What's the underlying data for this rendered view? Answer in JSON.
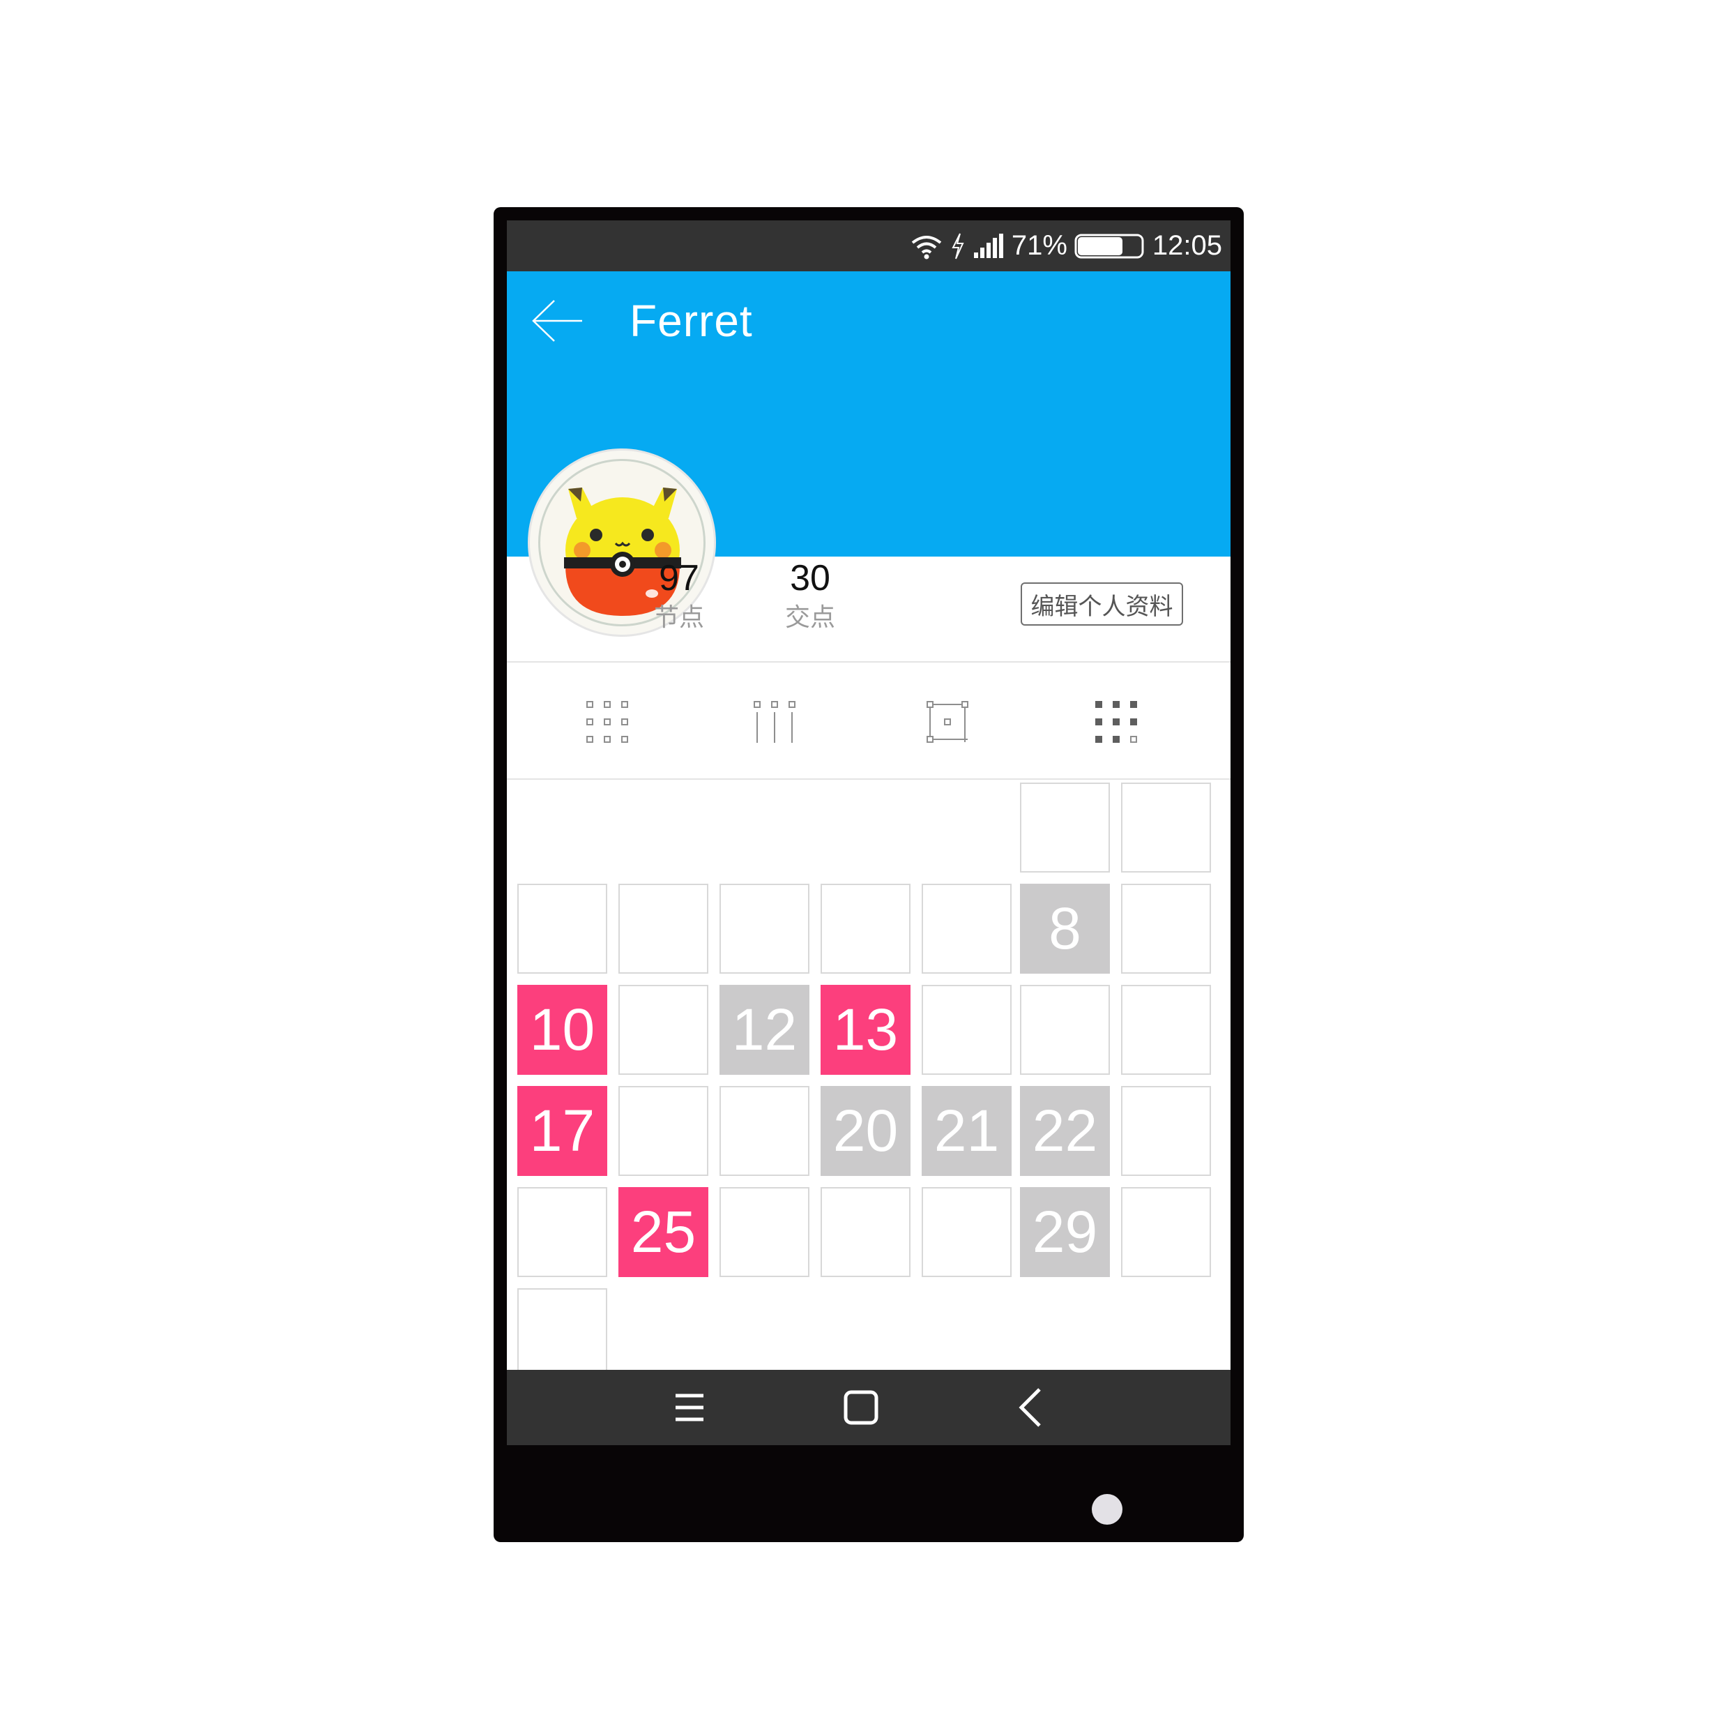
{
  "status": {
    "battery": "71%",
    "time": "12:05",
    "battery_level": 0.71
  },
  "header": {
    "title": "Ferret"
  },
  "profile": {
    "stats": [
      {
        "value": "97",
        "label": "节点"
      },
      {
        "value": "30",
        "label": "交点"
      }
    ],
    "edit_label": "编辑个人资料"
  },
  "view_tabs": [
    "grid-icon",
    "columns-icon",
    "frame-icon",
    "grid-bold-icon"
  ],
  "calendar": {
    "cells": [
      {
        "label": "",
        "style": "empty"
      },
      {
        "label": "",
        "style": "empty"
      },
      {
        "label": "",
        "style": "empty"
      },
      {
        "label": "",
        "style": "empty"
      },
      {
        "label": "",
        "style": "empty"
      },
      {
        "label": "",
        "style": "empty"
      },
      {
        "label": "",
        "style": "empty"
      },
      {
        "label": "8",
        "style": "gray"
      },
      {
        "label": "",
        "style": "empty"
      },
      {
        "label": "10",
        "style": "pink"
      },
      {
        "label": "",
        "style": "empty"
      },
      {
        "label": "12",
        "style": "gray"
      },
      {
        "label": "13",
        "style": "pink"
      },
      {
        "label": "",
        "style": "empty"
      },
      {
        "label": "",
        "style": "empty"
      },
      {
        "label": "",
        "style": "empty"
      },
      {
        "label": "17",
        "style": "pink"
      },
      {
        "label": "",
        "style": "empty"
      },
      {
        "label": "",
        "style": "empty"
      },
      {
        "label": "20",
        "style": "gray"
      },
      {
        "label": "21",
        "style": "gray"
      },
      {
        "label": "22",
        "style": "gray"
      },
      {
        "label": "",
        "style": "empty"
      },
      {
        "label": "",
        "style": "empty"
      },
      {
        "label": "25",
        "style": "pink"
      },
      {
        "label": "",
        "style": "empty"
      },
      {
        "label": "",
        "style": "empty"
      },
      {
        "label": "",
        "style": "empty"
      },
      {
        "label": "29",
        "style": "gray"
      },
      {
        "label": "",
        "style": "empty"
      },
      {
        "label": "",
        "style": "empty"
      }
    ]
  },
  "nav": [
    "menu-icon",
    "home-icon",
    "back-icon"
  ],
  "colors": {
    "header": "#06aaf2",
    "pink": "#fc3f7d",
    "gray": "#cbcacb",
    "bars": "#333333"
  }
}
